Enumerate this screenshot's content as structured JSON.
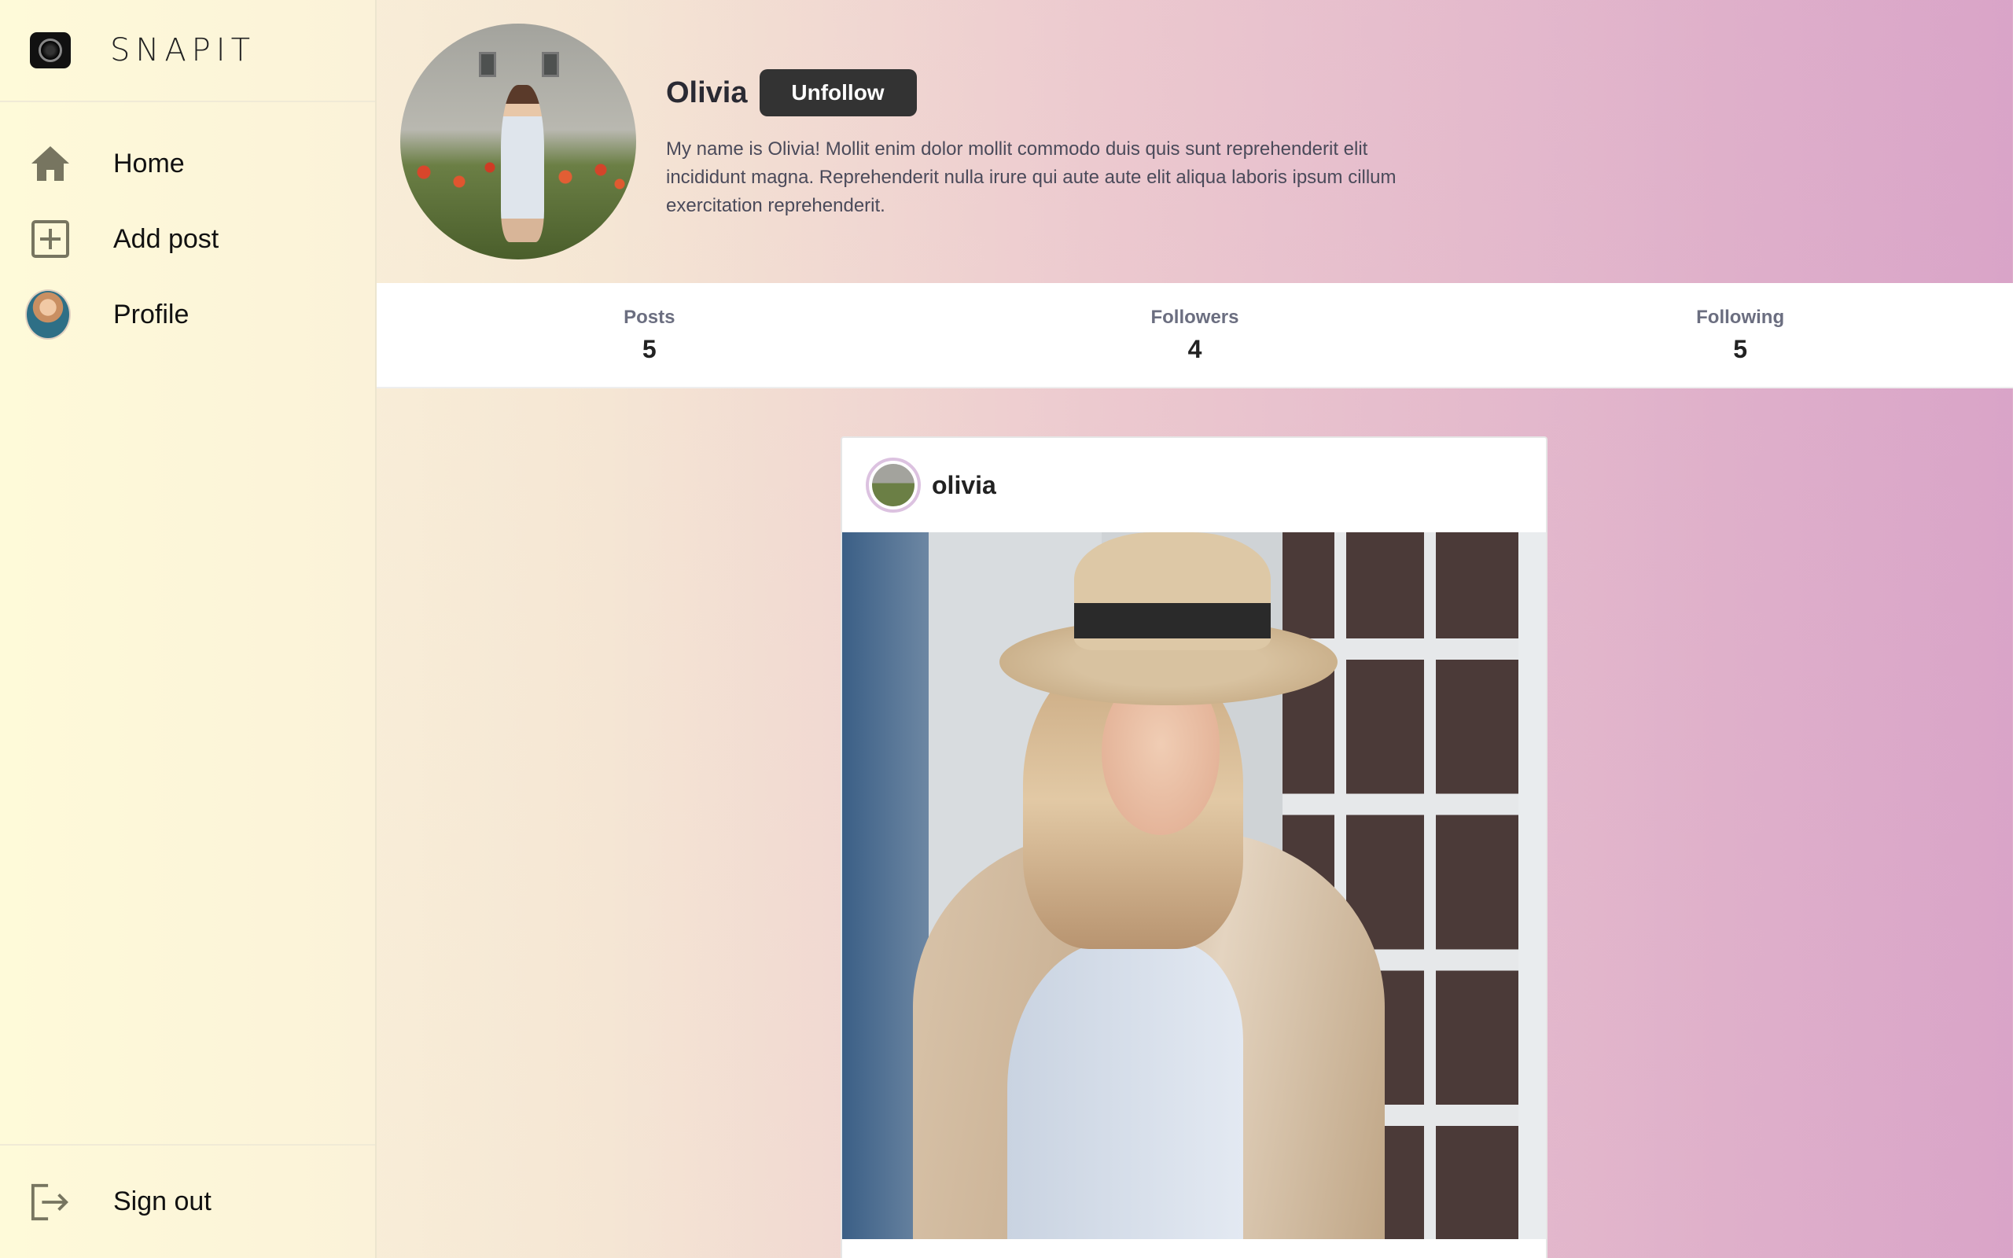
{
  "app": {
    "brand_name": "SNAPIT",
    "brand_icon": "camera-icon"
  },
  "sidebar": {
    "items": [
      {
        "label": "Home",
        "icon": "home-icon"
      },
      {
        "label": "Add post",
        "icon": "add-square-icon"
      },
      {
        "label": "Profile",
        "icon": "avatar"
      }
    ],
    "signout": {
      "label": "Sign out",
      "icon": "sign-out-icon"
    }
  },
  "profile": {
    "name": "Olivia",
    "unfollow_label": "Unfollow",
    "bio": "My name is Olivia! Mollit enim dolor mollit commodo duis quis sunt reprehenderit elit incididunt magna. Reprehenderit nulla irure qui aute aute elit aliqua laboris ipsum cillum exercitation reprehenderit."
  },
  "stats": [
    {
      "label": "Posts",
      "value": "5"
    },
    {
      "label": "Followers",
      "value": "4"
    },
    {
      "label": "Following",
      "value": "5"
    }
  ],
  "post": {
    "username": "olivia"
  },
  "colors": {
    "button_bg": "#333333",
    "sidebar_bg": "#fefad9",
    "gradient_end": "#d9a4c8"
  }
}
